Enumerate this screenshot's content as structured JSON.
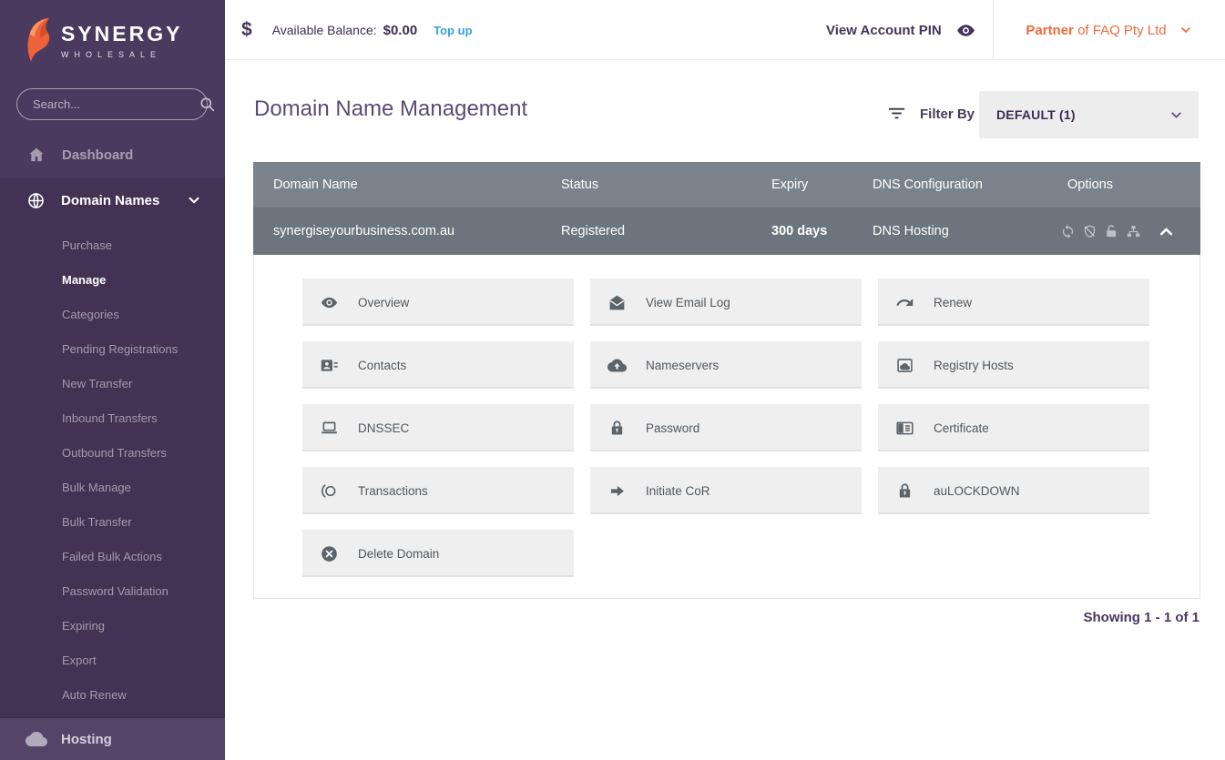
{
  "brand": {
    "name": "SYNERGY",
    "tagline": "WHOLESALE"
  },
  "topbar": {
    "currency_symbol": "$",
    "balance_label": "Available Balance:",
    "balance_value": "$0.00",
    "topup_label": "Top up",
    "view_pin_label": "View Account PIN",
    "partner_prefix": "Partner",
    "partner_suffix": " of FAQ Pty Ltd"
  },
  "sidebar": {
    "search_placeholder": "Search...",
    "dashboard": "Dashboard",
    "domain_names": "Domain Names",
    "subitems": [
      "Purchase",
      "Manage",
      "Categories",
      "Pending Registrations",
      "New Transfer",
      "Inbound Transfers",
      "Outbound Transfers",
      "Bulk Manage",
      "Bulk Transfer",
      "Failed Bulk Actions",
      "Password Validation",
      "Expiring",
      "Export",
      "Auto Renew"
    ],
    "active_subitem": "Manage",
    "hosting": "Hosting"
  },
  "main": {
    "title": "Domain Name Management",
    "filter_label": "Filter By",
    "filter_value": "DEFAULT (1)",
    "showing": "Showing 1 - 1 of 1"
  },
  "table": {
    "headers": [
      "Domain Name",
      "Status",
      "Expiry",
      "DNS Configuration",
      "Options"
    ],
    "row": {
      "domain": "synergiseyourbusiness.com.au",
      "status": "Registered",
      "expiry": "300 days",
      "dns": "DNS Hosting",
      "option_icons": [
        "sync-icon",
        "shield-off-icon",
        "unlock-icon",
        "sitemap-icon"
      ],
      "expanded": true
    }
  },
  "actions": [
    {
      "label": "Overview",
      "icon": "eye-icon"
    },
    {
      "label": "View Email Log",
      "icon": "mail-open-icon"
    },
    {
      "label": "Renew",
      "icon": "redo-icon"
    },
    {
      "label": "Contacts",
      "icon": "contact-card-icon"
    },
    {
      "label": "Nameservers",
      "icon": "cloud-upload-icon"
    },
    {
      "label": "Registry Hosts",
      "icon": "cloud-box-icon"
    },
    {
      "label": "DNSSEC",
      "icon": "laptop-icon"
    },
    {
      "label": "Password",
      "icon": "lock-icon"
    },
    {
      "label": "Certificate",
      "icon": "certificate-card-icon"
    },
    {
      "label": "Transactions",
      "icon": "transactions-icon"
    },
    {
      "label": "Initiate CoR",
      "icon": "arrow-right-icon"
    },
    {
      "label": "auLOCKDOWN",
      "icon": "lock-icon"
    },
    {
      "label": "Delete Domain",
      "icon": "x-circle-icon"
    }
  ],
  "colors": {
    "sidebar_purple": "#4B3A5F",
    "sidebar_section_purple": "#433254",
    "hosting_purple": "#544468",
    "accent_orange": "#F06A3B",
    "link_blue": "#35A0DB",
    "table_header_gray": "#7A838C",
    "table_row_gray": "#6C757E",
    "text_purple": "#4A3560",
    "tile_gray": "#EFEFEF"
  }
}
